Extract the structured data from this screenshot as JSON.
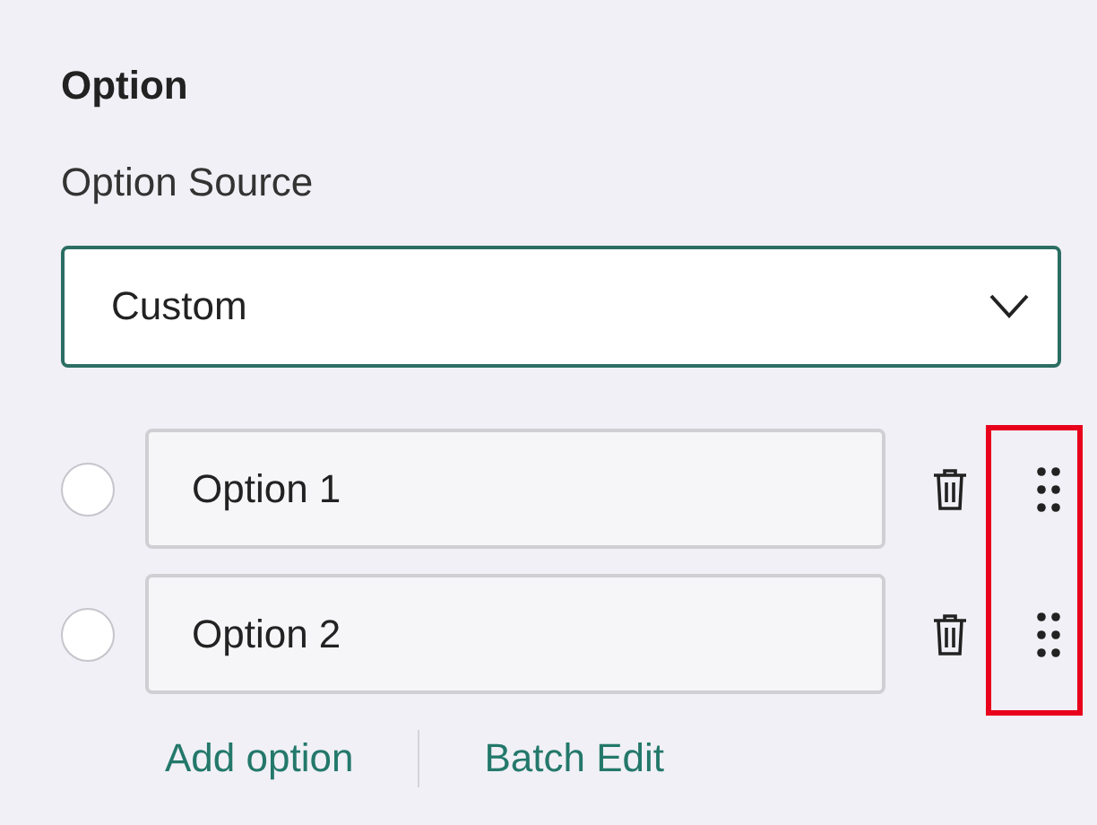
{
  "section_title": "Option",
  "source": {
    "label": "Option Source",
    "value": "Custom"
  },
  "options": [
    {
      "value": "Option 1",
      "selected": false
    },
    {
      "value": "Option 2",
      "selected": false
    }
  ],
  "actions": [
    "Add option",
    "Batch Edit"
  ],
  "highlight_drag_handles": true
}
